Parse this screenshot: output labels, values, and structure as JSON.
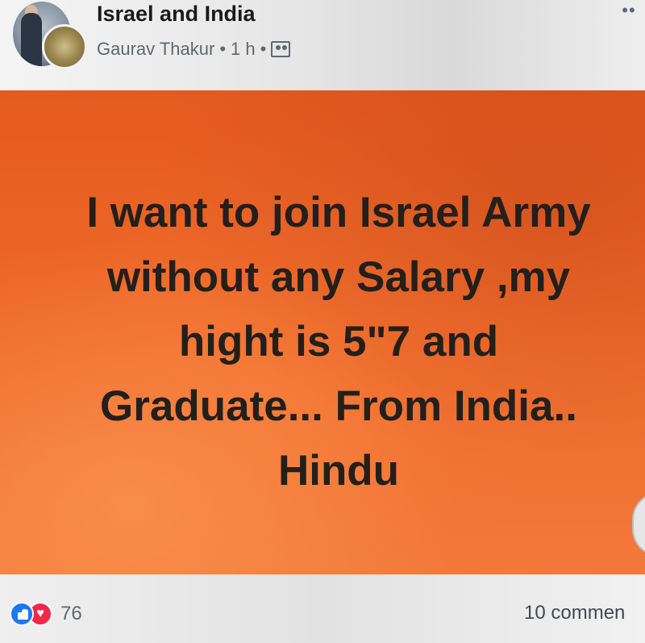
{
  "post": {
    "group_name": "Israel and India",
    "author": "Gaurav Thakur",
    "time": "1 h",
    "separator": "•",
    "more_icon_glyph": "••",
    "body": "I want to join Israel Army\nwithout any Salary ,my\nhight is 5\"7 and\nGraduate... From India..\nHindu",
    "background_color": "#ee6a2a",
    "text_color": "#231f1c"
  },
  "footer": {
    "reaction_count": "76",
    "comments": "10 commen",
    "like_color": "#1d77f2",
    "love_color": "#f0284a",
    "love_glyph": "♥"
  },
  "icons": {
    "group_privacy": "group-members-icon",
    "more": "more-options-icon",
    "like": "like-reaction-icon",
    "love": "love-reaction-icon"
  }
}
